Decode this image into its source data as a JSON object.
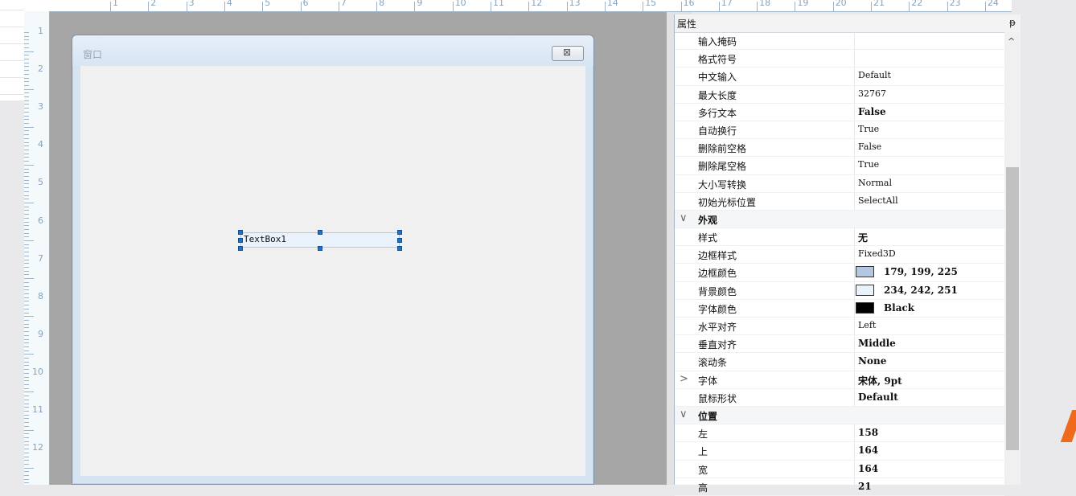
{
  "ruler": {
    "top_labels": [
      "1",
      "2",
      "3",
      "4",
      "5",
      "6",
      "7",
      "8",
      "9",
      "10",
      "11",
      "12",
      "13",
      "14",
      "15",
      "16",
      "17",
      "18",
      "19",
      "20",
      "21",
      "22",
      "23",
      "24"
    ],
    "left_labels": [
      "1",
      "2",
      "3",
      "4",
      "5",
      "6",
      "7",
      "8",
      "9",
      "10",
      "11",
      "12"
    ]
  },
  "form": {
    "title": "窗口",
    "close_glyph": "⊠",
    "textbox_text": "TextBox1"
  },
  "properties": {
    "title": "属性",
    "pin_glyph": "ᵽ",
    "scroll_up_glyph": "^",
    "rows": [
      {
        "name": "输入掩码",
        "value": ""
      },
      {
        "name": "格式符号",
        "value": ""
      },
      {
        "name": "中文输入",
        "value": "Default"
      },
      {
        "name": "最大长度",
        "value": "32767"
      },
      {
        "name": "多行文本",
        "value": "False",
        "bold": true
      },
      {
        "name": "自动换行",
        "value": "True"
      },
      {
        "name": "删除前空格",
        "value": "False"
      },
      {
        "name": "删除尾空格",
        "value": "True"
      },
      {
        "name": "大小写转换",
        "value": "Normal"
      },
      {
        "name": "初始光标位置",
        "value": "SelectAll"
      },
      {
        "name": "外观",
        "category": true,
        "toggle": "∨"
      },
      {
        "name": "样式",
        "value": "无",
        "bold": true
      },
      {
        "name": "边框样式",
        "value": "Fixed3D"
      },
      {
        "name": "边框颜色",
        "value": "179, 199, 225",
        "bold": true,
        "swatch": "#b3c7e1"
      },
      {
        "name": "背景颜色",
        "value": "234, 242, 251",
        "bold": true,
        "swatch": "#eaf2fb"
      },
      {
        "name": "字体颜色",
        "value": "Black",
        "bold": true,
        "swatch": "#000000"
      },
      {
        "name": "水平对齐",
        "value": "Left"
      },
      {
        "name": "垂直对齐",
        "value": "Middle",
        "bold": true
      },
      {
        "name": "滚动条",
        "value": "None",
        "bold": true
      },
      {
        "name": "字体",
        "value": "宋体, 9pt",
        "bold": true,
        "toggle": ">"
      },
      {
        "name": "鼠标形状",
        "value": "Default",
        "bold": true
      },
      {
        "name": "位置",
        "category": true,
        "toggle": "∨"
      },
      {
        "name": "左",
        "value": "158",
        "bold": true
      },
      {
        "name": "上",
        "value": "164",
        "bold": true
      },
      {
        "name": "宽",
        "value": "164",
        "bold": true
      },
      {
        "name": "高",
        "value": "21",
        "bold": true
      }
    ]
  }
}
